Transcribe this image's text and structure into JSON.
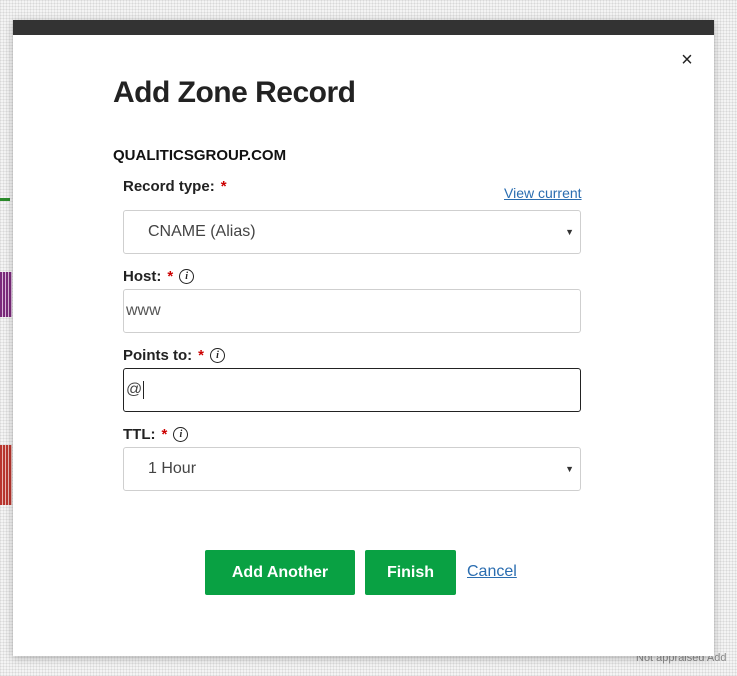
{
  "background": {
    "fragment_bottom": "Not appraised  Add"
  },
  "modal": {
    "title": "Add Zone Record",
    "close_glyph": "×",
    "domain": "QUALITICSGROUP.COM",
    "record_type": {
      "label": "Record type:",
      "required_mark": "*",
      "view_current_link": "View current",
      "value": "CNAME (Alias)"
    },
    "host": {
      "label": "Host:",
      "required_mark": "*",
      "info_icon": "i",
      "value": "www"
    },
    "points_to": {
      "label": "Points to:",
      "required_mark": "*",
      "info_icon": "i",
      "value": "@"
    },
    "ttl": {
      "label": "TTL:",
      "required_mark": "*",
      "info_icon": "i",
      "value": "1 Hour"
    },
    "buttons": {
      "add_another": "Add Another",
      "finish": "Finish",
      "cancel": "Cancel"
    }
  },
  "colors": {
    "primary_button": "#09a143",
    "link": "#2a6db0",
    "required": "#cc0000",
    "topbar": "#333333"
  }
}
